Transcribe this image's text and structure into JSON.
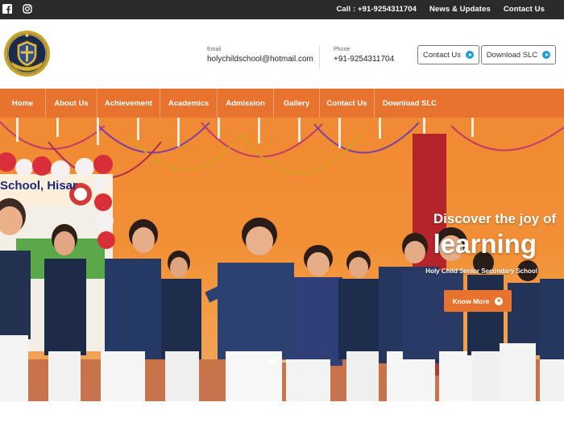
{
  "topbar": {
    "social": [
      "facebook-icon",
      "instagram-icon"
    ],
    "links": [
      "Call : +91-9254311704",
      "News & Updates",
      "Contact Us"
    ]
  },
  "header": {
    "logo": "school-crest-logo",
    "email_label": "Email",
    "email_value": "holychildschool@hotmail.com",
    "phone_label": "Phone",
    "phone_value": "+91-9254311704",
    "contact_button": "Contact Us",
    "download_button": "Download SLC"
  },
  "nav": {
    "items": [
      "Home",
      "About Us",
      "Achievement",
      "Academics",
      "Admission",
      "Gallery",
      "Contact Us",
      "Download SLC"
    ]
  },
  "hero": {
    "title_line1": "Discover the joy of",
    "title_line2": "learning",
    "subtitle": "Holy Child Senior Secondary School",
    "button_label": "Know More",
    "banner_text": "School, Hisar",
    "slides": 2,
    "active_slide": 1
  },
  "colors": {
    "accent": "#e8732f",
    "topbar": "#2b2b2b",
    "button_icon": "#1e9fd8"
  }
}
